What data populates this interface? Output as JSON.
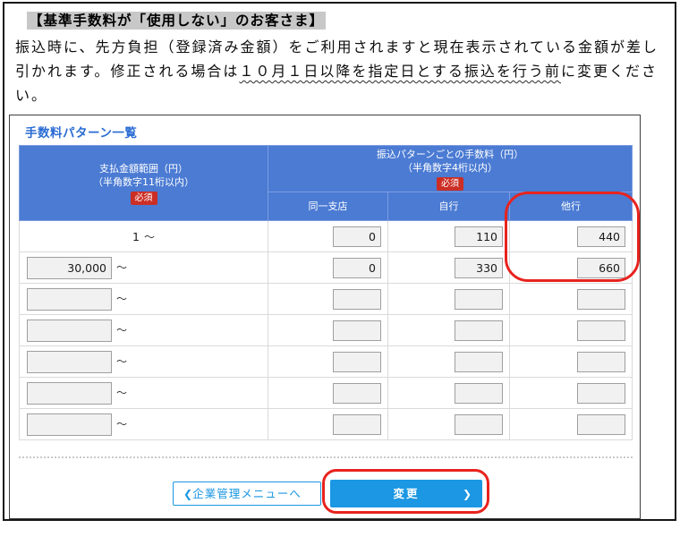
{
  "doc": {
    "title": "【基準手数料が「使用しない」のお客さま】",
    "body_start": "振込時に、先方負担（登録済み金額）をご利用されますと現在表示されている金額が差し引かれます。修正される場合は",
    "body_underlined": "１０月１日以降を指定日とする振込を行う前",
    "body_end": "に変更ください。"
  },
  "panel": {
    "title": "手数料パターン一覧",
    "table": {
      "range_header_line1": "支払金額範囲（円）",
      "range_header_line2": "（半角数字11桁以内）",
      "fees_header_line1": "振込パターンごとの手数料（円）",
      "fees_header_line2": "（半角数字4桁以内）",
      "required": "必須",
      "columns": [
        "同一支店",
        "自行",
        "他行"
      ],
      "tilde": "～",
      "rows": [
        {
          "range": "1",
          "same_branch": "0",
          "own_bank": "110",
          "other_bank": "440"
        },
        {
          "range": "30,000",
          "same_branch": "0",
          "own_bank": "330",
          "other_bank": "660"
        },
        {
          "range": "",
          "same_branch": "",
          "own_bank": "",
          "other_bank": ""
        },
        {
          "range": "",
          "same_branch": "",
          "own_bank": "",
          "other_bank": ""
        },
        {
          "range": "",
          "same_branch": "",
          "own_bank": "",
          "other_bank": ""
        },
        {
          "range": "",
          "same_branch": "",
          "own_bank": "",
          "other_bank": ""
        },
        {
          "range": "",
          "same_branch": "",
          "own_bank": "",
          "other_bank": ""
        }
      ]
    },
    "buttons": {
      "back": "企業管理メニューへ",
      "submit": "変更"
    }
  },
  "icons": {
    "chevron_left": "❮",
    "chevron_right": "❯"
  },
  "colors": {
    "table_header_blue": "#4b7bd3",
    "action_blue": "#1b97e3",
    "annotation_red": "#e8231e",
    "required_badge_red": "#cb2e25",
    "title_highlight_gray": "#c8c8c8",
    "panel_title_blue": "#2a6cd3"
  }
}
